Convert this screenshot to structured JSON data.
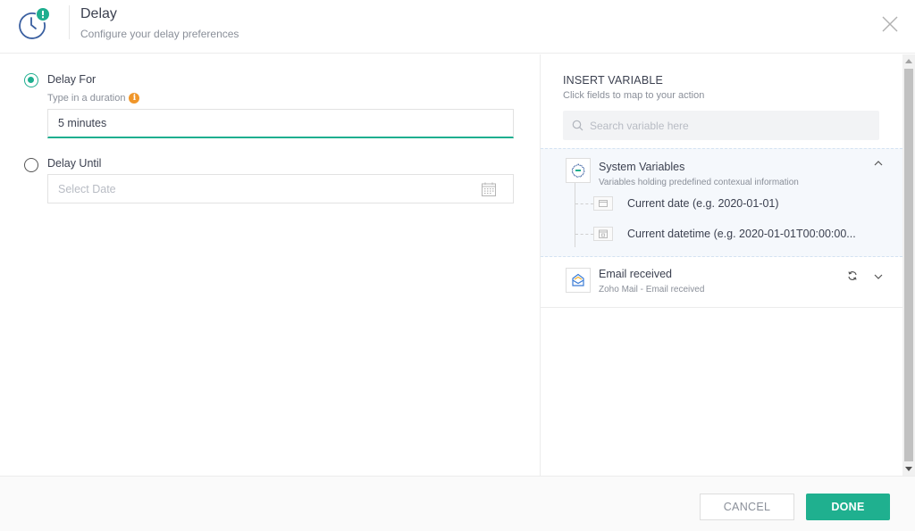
{
  "header": {
    "icon": "clock-alert-icon",
    "title": "Delay",
    "subtitle": "Configure your delay preferences",
    "close_icon": "close-icon"
  },
  "delay_options": {
    "delay_for": {
      "label": "Delay For",
      "selected": true,
      "hint": "Type in a duration",
      "hint_icon": "info-icon",
      "value": "5 minutes"
    },
    "delay_until": {
      "label": "Delay Until",
      "selected": false,
      "placeholder": "Select Date",
      "icon": "calendar-icon"
    }
  },
  "insert_variable": {
    "title": "INSERT VARIABLE",
    "subtitle": "Click fields to map to your action",
    "search_placeholder": "Search variable here",
    "groups": [
      {
        "title": "System Variables",
        "subtitle": "Variables holding predefined contexual information",
        "expanded": true,
        "items": [
          {
            "label": "Current date (e.g. 2020-01-01)",
            "icon": "date-icon"
          },
          {
            "label": "Current datetime (e.g. 2020-01-01T00:00:00...",
            "icon": "datetime-icon"
          }
        ]
      },
      {
        "title": "Email received",
        "subtitle": "Zoho Mail - Email received",
        "expanded": false
      }
    ]
  },
  "footer": {
    "cancel_label": "CANCEL",
    "done_label": "DONE"
  },
  "colors": {
    "accent": "#1fb08f",
    "info": "#f0962a",
    "icon_blue": "#3a5fa0"
  }
}
